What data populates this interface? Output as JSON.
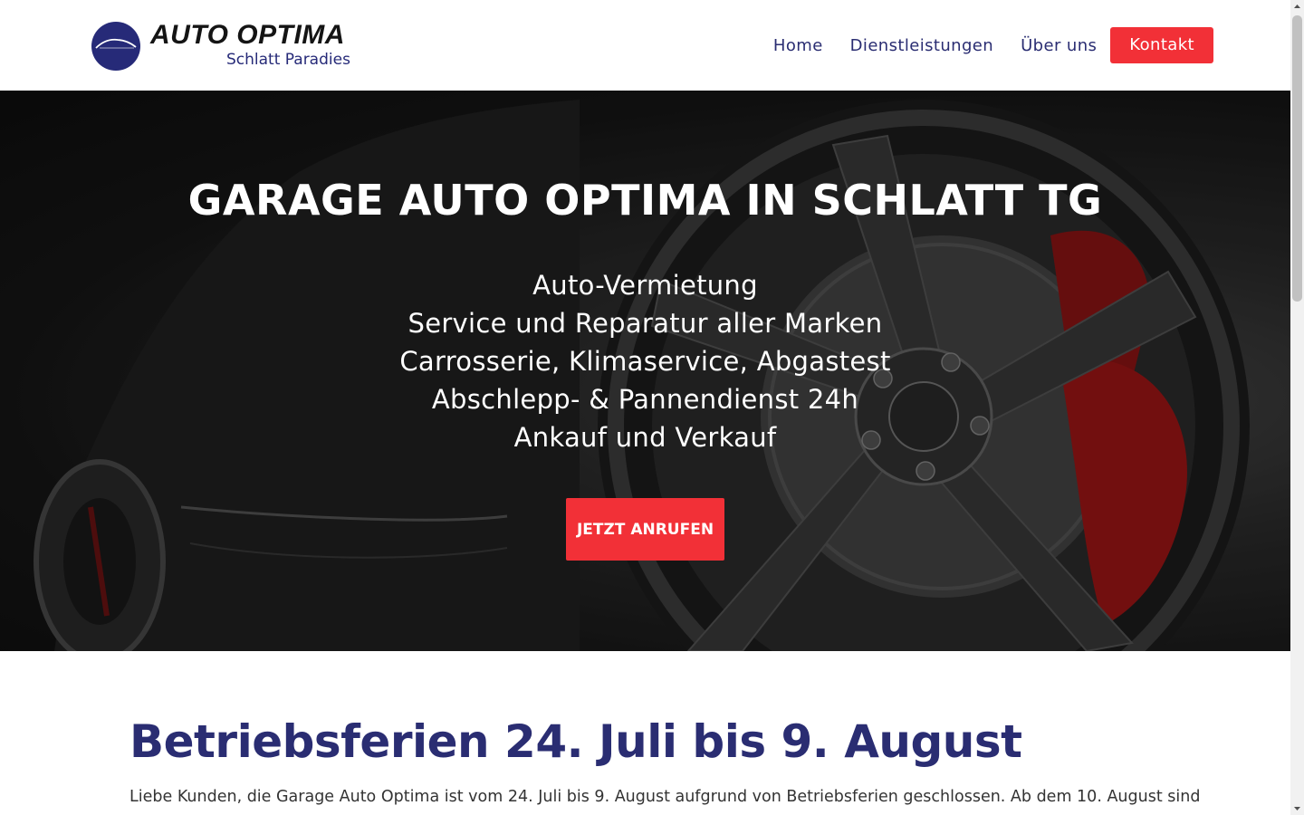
{
  "header": {
    "logo": {
      "title": "AUTO OPTIMA",
      "subtitle": "Schlatt Paradies",
      "mark_color": "#262a78"
    },
    "nav": [
      {
        "label": "Home"
      },
      {
        "label": "Dienstleistungen"
      },
      {
        "label": "Über uns"
      }
    ],
    "contact_button": "Kontakt"
  },
  "hero": {
    "title": "GARAGE AUTO OPTIMA IN SCHLATT TG",
    "services": [
      "Auto-Vermietung",
      "Service und Reparatur aller Marken",
      "Carrosserie, Klimaservice, Abgastest",
      "Abschlepp- & Pannendienst 24h",
      "Ankauf und Verkauf"
    ],
    "cta_button": "JETZT ANRUFEN",
    "background_image": "black-sports-car-wheel-red-brake-caliper"
  },
  "notice": {
    "title": "Betriebsferien 24. Juli bis 9. August",
    "text": "Liebe Kunden, die Garage Auto Optima ist vom 24. Juli bis 9. August aufgrund von Betriebsferien geschlossen. Ab dem 10. August sind"
  },
  "colors": {
    "brand_navy": "#2a2d72",
    "accent_red": "#f23037",
    "hero_dark": "#161616"
  }
}
